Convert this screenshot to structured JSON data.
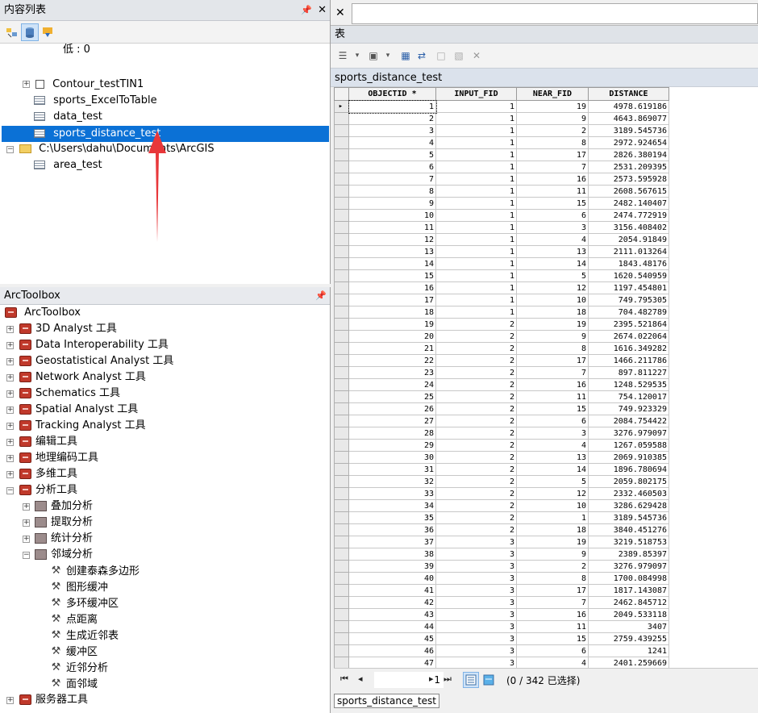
{
  "toc": {
    "title": "内容列表",
    "pin": "Ⅲ",
    "close": "✕",
    "items": [
      {
        "label": "低 : 0"
      },
      {
        "label": "Contour_testTIN1"
      },
      {
        "label": "sports_ExcelToTable"
      },
      {
        "label": "data_test"
      },
      {
        "label": "sports_distance_test"
      },
      {
        "label": "C:\\Users\\dahu\\Documents\\ArcGIS"
      },
      {
        "label": "area_test"
      }
    ]
  },
  "toolbox": {
    "title": "ArcToolbox",
    "root": "ArcToolbox",
    "toolboxes": [
      "3D Analyst 工具",
      "Data Interoperability 工具",
      "Geostatistical Analyst 工具",
      "Network Analyst 工具",
      "Schematics 工具",
      "Spatial Analyst 工具",
      "Tracking Analyst 工具",
      "编辑工具",
      "地理编码工具",
      "多维工具",
      "分析工具"
    ],
    "toolsets": [
      "叠加分析",
      "提取分析",
      "统计分析",
      "邻域分析"
    ],
    "tools": [
      "创建泰森多边形",
      "图形缓冲",
      "多环缓冲区",
      "点距离",
      "生成近邻表",
      "缓冲区",
      "近邻分析",
      "面邻域"
    ],
    "after": [
      "服务器工具"
    ]
  },
  "table_window": {
    "title": "表",
    "table_name": "sports_distance_test",
    "columns": [
      "OBJECTID *",
      "INPUT_FID",
      "NEAR_FID",
      "DISTANCE"
    ],
    "rows": [
      [
        1,
        1,
        19,
        "4978.619186"
      ],
      [
        2,
        1,
        9,
        "4643.869077"
      ],
      [
        3,
        1,
        2,
        "3189.545736"
      ],
      [
        4,
        1,
        8,
        "2972.924654"
      ],
      [
        5,
        1,
        17,
        "2826.380194"
      ],
      [
        6,
        1,
        7,
        "2531.209395"
      ],
      [
        7,
        1,
        16,
        "2573.595928"
      ],
      [
        8,
        1,
        11,
        "2608.567615"
      ],
      [
        9,
        1,
        15,
        "2482.140407"
      ],
      [
        10,
        1,
        6,
        "2474.772919"
      ],
      [
        11,
        1,
        3,
        "3156.408402"
      ],
      [
        12,
        1,
        4,
        "2054.91849"
      ],
      [
        13,
        1,
        13,
        "2111.013264"
      ],
      [
        14,
        1,
        14,
        "1843.48176"
      ],
      [
        15,
        1,
        5,
        "1620.540959"
      ],
      [
        16,
        1,
        12,
        "1197.454801"
      ],
      [
        17,
        1,
        10,
        "749.795305"
      ],
      [
        18,
        1,
        18,
        "704.482789"
      ],
      [
        19,
        2,
        19,
        "2395.521864"
      ],
      [
        20,
        2,
        9,
        "2674.022064"
      ],
      [
        21,
        2,
        8,
        "1616.349282"
      ],
      [
        22,
        2,
        17,
        "1466.211786"
      ],
      [
        23,
        2,
        7,
        "897.811227"
      ],
      [
        24,
        2,
        16,
        "1248.529535"
      ],
      [
        25,
        2,
        11,
        "754.120017"
      ],
      [
        26,
        2,
        15,
        "749.923329"
      ],
      [
        27,
        2,
        6,
        "2084.754422"
      ],
      [
        28,
        2,
        3,
        "3276.979097"
      ],
      [
        29,
        2,
        4,
        "1267.059588"
      ],
      [
        30,
        2,
        13,
        "2069.910385"
      ],
      [
        31,
        2,
        14,
        "1896.780694"
      ],
      [
        32,
        2,
        5,
        "2059.802175"
      ],
      [
        33,
        2,
        12,
        "2332.460503"
      ],
      [
        34,
        2,
        10,
        "3286.629428"
      ],
      [
        35,
        2,
        1,
        "3189.545736"
      ],
      [
        36,
        2,
        18,
        "3840.451276"
      ],
      [
        37,
        3,
        19,
        "3219.518753"
      ],
      [
        38,
        3,
        9,
        "2389.85397"
      ],
      [
        39,
        3,
        2,
        "3276.979097"
      ],
      [
        40,
        3,
        8,
        "1700.084998"
      ],
      [
        41,
        3,
        17,
        "1817.143087"
      ],
      [
        42,
        3,
        7,
        "2462.845712"
      ],
      [
        43,
        3,
        16,
        "2049.533118"
      ],
      [
        44,
        3,
        11,
        "3407"
      ],
      [
        45,
        3,
        15,
        "2759.439255"
      ],
      [
        46,
        3,
        6,
        "1241"
      ],
      [
        47,
        3,
        4,
        "2401.259669"
      ]
    ],
    "page_value": "1",
    "status": "(0 / 342 已选择)",
    "bottom_tab": "sports_distance_test"
  },
  "colors": {
    "selection": "#0b71d6",
    "arrow": "#e8373a"
  }
}
